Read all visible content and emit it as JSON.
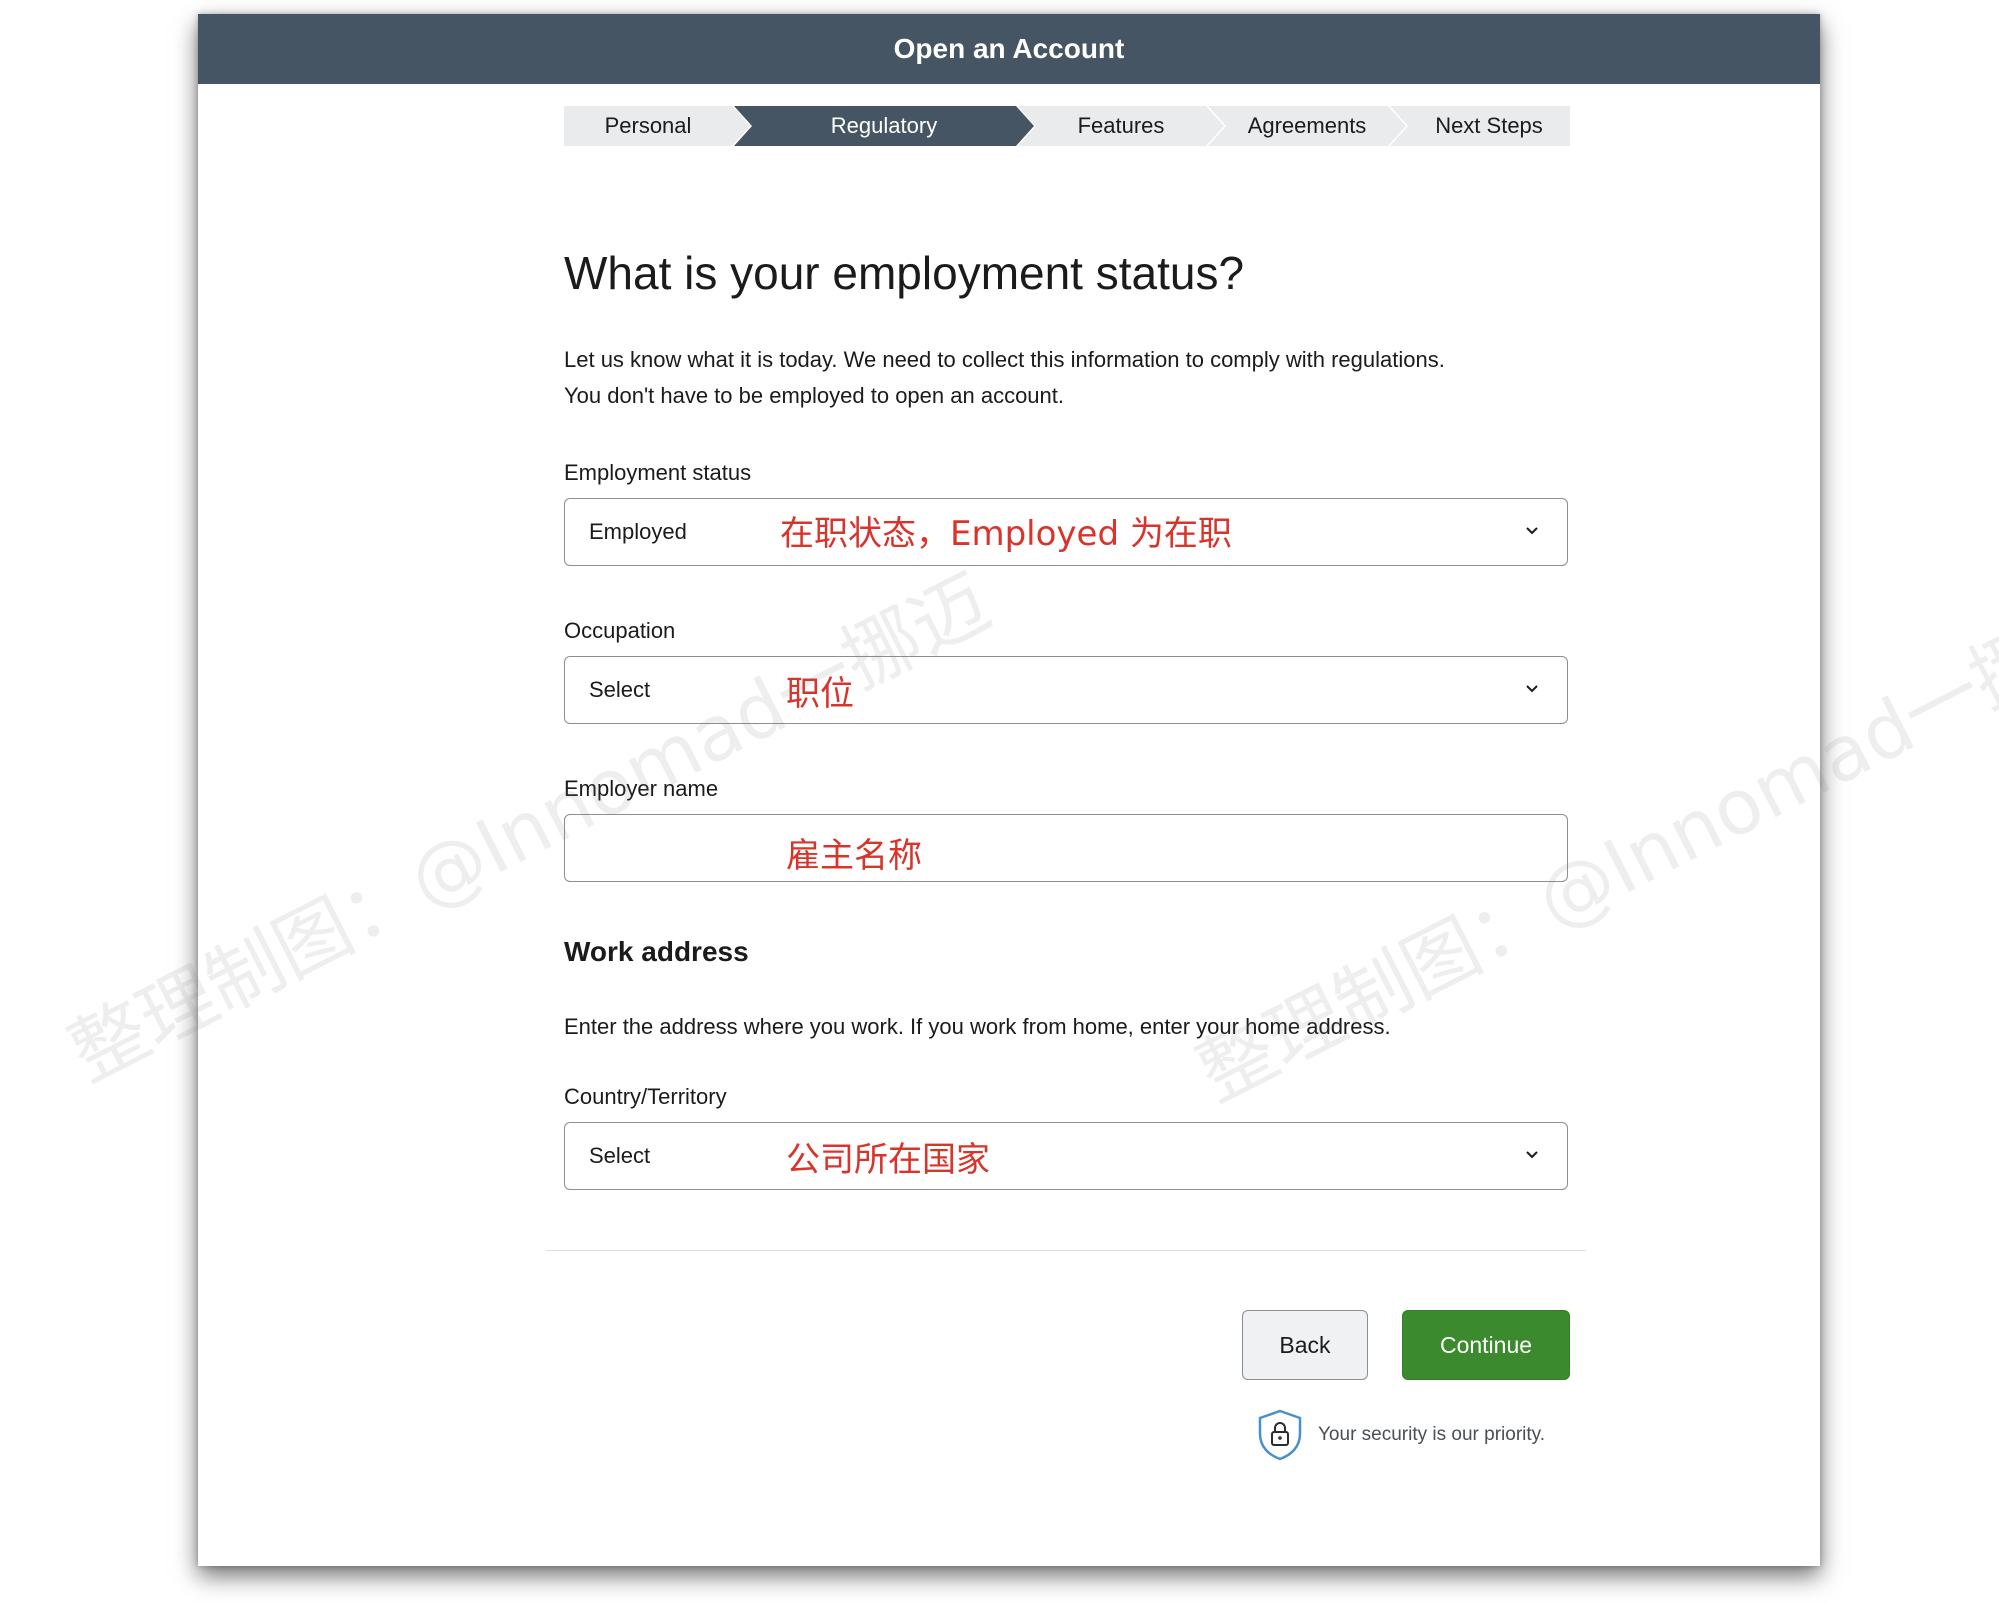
{
  "window": {
    "title": "Open an Account"
  },
  "steps": [
    {
      "label": "Personal",
      "state": "done"
    },
    {
      "label": "Regulatory",
      "state": "active"
    },
    {
      "label": "Features",
      "state": "upcoming"
    },
    {
      "label": "Agreements",
      "state": "upcoming"
    },
    {
      "label": "Next Steps",
      "state": "upcoming"
    }
  ],
  "page": {
    "heading": "What is your employment status?",
    "lead_line1": "Let us know what it is today. We need to collect this information to comply with regulations.",
    "lead_line2": "You don't have to be employed to open an account."
  },
  "form": {
    "employment_status": {
      "label": "Employment status",
      "value": "Employed",
      "annotation": "在职状态，Employed 为在职"
    },
    "occupation": {
      "label": "Occupation",
      "value": "Select",
      "annotation": "职位"
    },
    "employer_name": {
      "label": "Employer name",
      "value": "",
      "annotation": "雇主名称"
    },
    "work_address": {
      "heading": "Work address",
      "description": "Enter the address where you work. If you work from home, enter your home address."
    },
    "country": {
      "label": "Country/Territory",
      "value": "Select",
      "annotation": "公司所在国家"
    }
  },
  "actions": {
    "back_label": "Back",
    "continue_label": "Continue"
  },
  "security": {
    "text": "Your security is our priority.",
    "icon": "shield-lock-icon"
  },
  "watermarks": [
    {
      "text": "整理制图：@Innomad一挪迈"
    },
    {
      "text": "整理制图：@Innomad一挪迈"
    }
  ],
  "colors": {
    "titlebar": "#465563",
    "step_active": "#465563",
    "step_inactive": "#e9ebed",
    "continue": "#3b8a2e",
    "annotation": "#d9342b"
  }
}
